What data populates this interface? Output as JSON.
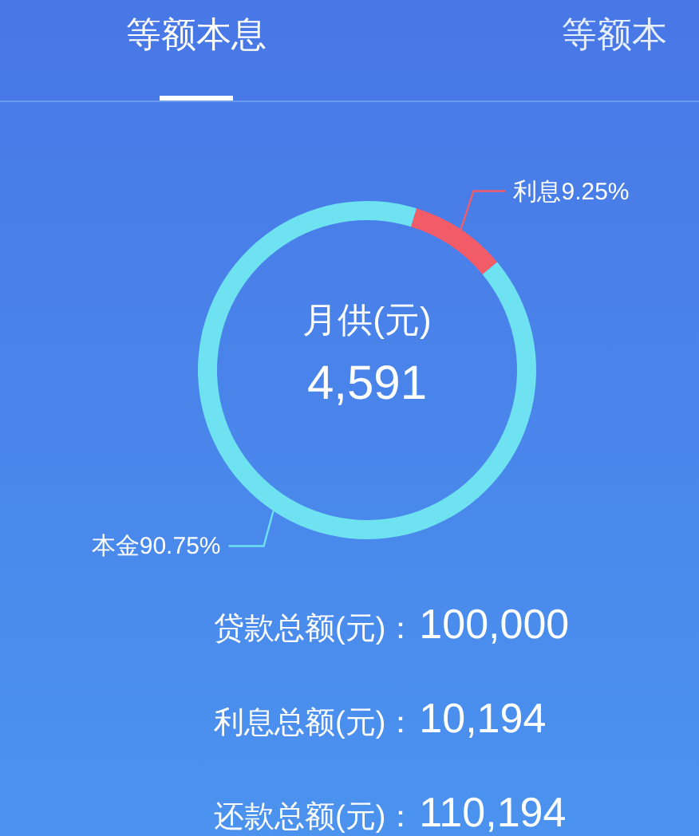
{
  "tabs": [
    {
      "label": "等额本息",
      "selected": true
    },
    {
      "label": "等额本",
      "selected": false
    }
  ],
  "summary": {
    "caption": "月供(元)",
    "amount": "4,591",
    "chart_data": {
      "type": "donut",
      "categories": [
        "利息",
        "本金"
      ],
      "values": [
        9.25,
        90.75
      ],
      "value_labels": [
        "9.25%",
        "90.75%"
      ]
    }
  },
  "totals": [
    {
      "label": "贷款总额(元)：",
      "value": "100,000"
    },
    {
      "label": "利息总额(元)：",
      "value": "10,194"
    },
    {
      "label": "还款总额(元)：",
      "value": "110,194"
    }
  ]
}
